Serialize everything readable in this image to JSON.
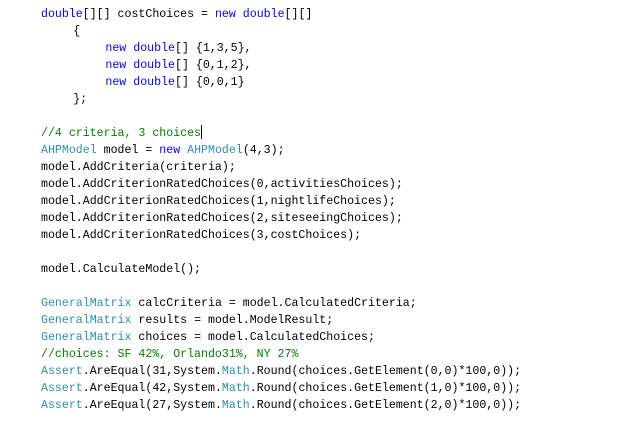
{
  "editor": {
    "lines": [
      {
        "indent": 0,
        "tokens": [
          {
            "k": "kw",
            "t": "double"
          },
          {
            "k": "pl",
            "t": "[][] costChoices = "
          },
          {
            "k": "kw",
            "t": "new"
          },
          {
            "k": "pl",
            "t": " "
          },
          {
            "k": "kw",
            "t": "double"
          },
          {
            "k": "pl",
            "t": "[][]"
          }
        ]
      },
      {
        "indent": 4,
        "tokens": [
          {
            "k": "pl",
            "t": "{"
          }
        ]
      },
      {
        "indent": 8,
        "tokens": [
          {
            "k": "kw",
            "t": "new"
          },
          {
            "k": "pl",
            "t": " "
          },
          {
            "k": "kw",
            "t": "double"
          },
          {
            "k": "pl",
            "t": "[] {1,3,5},"
          }
        ]
      },
      {
        "indent": 8,
        "tokens": [
          {
            "k": "kw",
            "t": "new"
          },
          {
            "k": "pl",
            "t": " "
          },
          {
            "k": "kw",
            "t": "double"
          },
          {
            "k": "pl",
            "t": "[] {0,1,2},"
          }
        ]
      },
      {
        "indent": 8,
        "tokens": [
          {
            "k": "kw",
            "t": "new"
          },
          {
            "k": "pl",
            "t": " "
          },
          {
            "k": "kw",
            "t": "double"
          },
          {
            "k": "pl",
            "t": "[] {0,0,1}"
          }
        ]
      },
      {
        "indent": 4,
        "tokens": [
          {
            "k": "pl",
            "t": "};"
          }
        ]
      },
      {
        "indent": 0,
        "tokens": []
      },
      {
        "indent": 0,
        "caret": true,
        "tokens": [
          {
            "k": "cm",
            "t": "//4 criteria, 3 choices"
          }
        ]
      },
      {
        "indent": 0,
        "tokens": [
          {
            "k": "type",
            "t": "AHPModel"
          },
          {
            "k": "pl",
            "t": " model = "
          },
          {
            "k": "kw",
            "t": "new"
          },
          {
            "k": "pl",
            "t": " "
          },
          {
            "k": "type",
            "t": "AHPModel"
          },
          {
            "k": "pl",
            "t": "(4,3);"
          }
        ]
      },
      {
        "indent": 0,
        "tokens": [
          {
            "k": "pl",
            "t": "model.AddCriteria(criteria);"
          }
        ]
      },
      {
        "indent": 0,
        "tokens": [
          {
            "k": "pl",
            "t": "model.AddCriterionRatedChoices(0,activitiesChoices);"
          }
        ]
      },
      {
        "indent": 0,
        "tokens": [
          {
            "k": "pl",
            "t": "model.AddCriterionRatedChoices(1,nightlifeChoices);"
          }
        ]
      },
      {
        "indent": 0,
        "tokens": [
          {
            "k": "pl",
            "t": "model.AddCriterionRatedChoices(2,siteseeingChoices);"
          }
        ]
      },
      {
        "indent": 0,
        "tokens": [
          {
            "k": "pl",
            "t": "model.AddCriterionRatedChoices(3,costChoices);"
          }
        ]
      },
      {
        "indent": 0,
        "tokens": []
      },
      {
        "indent": 0,
        "tokens": [
          {
            "k": "pl",
            "t": "model.CalculateModel();"
          }
        ]
      },
      {
        "indent": 0,
        "tokens": []
      },
      {
        "indent": 0,
        "tokens": [
          {
            "k": "type",
            "t": "GeneralMatrix"
          },
          {
            "k": "pl",
            "t": " calcCriteria = model.CalculatedCriteria;"
          }
        ]
      },
      {
        "indent": 0,
        "tokens": [
          {
            "k": "type",
            "t": "GeneralMatrix"
          },
          {
            "k": "pl",
            "t": " results = model.ModelResult;"
          }
        ]
      },
      {
        "indent": 0,
        "tokens": [
          {
            "k": "type",
            "t": "GeneralMatrix"
          },
          {
            "k": "pl",
            "t": " choices = model.CalculatedChoices;"
          }
        ]
      },
      {
        "indent": 0,
        "tokens": [
          {
            "k": "cm",
            "t": "//choices: SF 42%, Orlando31%, NY 27%"
          }
        ]
      },
      {
        "indent": 0,
        "tokens": [
          {
            "k": "type",
            "t": "Assert"
          },
          {
            "k": "pl",
            "t": ".AreEqual(31,System."
          },
          {
            "k": "type",
            "t": "Math"
          },
          {
            "k": "pl",
            "t": ".Round(choices.GetElement(0,0)*100,0));"
          }
        ]
      },
      {
        "indent": 0,
        "tokens": [
          {
            "k": "type",
            "t": "Assert"
          },
          {
            "k": "pl",
            "t": ".AreEqual(42,System."
          },
          {
            "k": "type",
            "t": "Math"
          },
          {
            "k": "pl",
            "t": ".Round(choices.GetElement(1,0)*100,0));"
          }
        ]
      },
      {
        "indent": 0,
        "tokens": [
          {
            "k": "type",
            "t": "Assert"
          },
          {
            "k": "pl",
            "t": ".AreEqual(27,System."
          },
          {
            "k": "type",
            "t": "Math"
          },
          {
            "k": "pl",
            "t": ".Round(choices.GetElement(2,0)*100,0));"
          }
        ]
      }
    ]
  }
}
